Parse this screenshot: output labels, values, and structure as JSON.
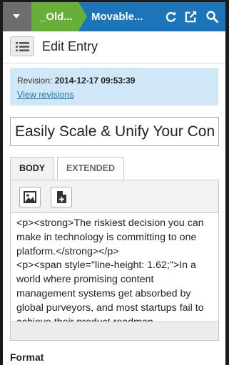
{
  "topbar": {
    "breadcrumb_site": "_Old...",
    "breadcrumb_app": "Movable...",
    "icons": [
      "menu-caret-icon",
      "refresh-icon",
      "external-link-icon",
      "search-icon"
    ],
    "colors": {
      "bar": "#1d75b9",
      "site": "#66b03a",
      "menu": "#6d6d6d"
    }
  },
  "toolbar": {
    "title": "Edit Entry",
    "list_icon": "list-icon"
  },
  "revision": {
    "label": "Revision:",
    "value": "2014-12-17 09:53:39",
    "link": "View revisions"
  },
  "entry": {
    "title_value": "Easily Scale & Unify Your Content"
  },
  "tabs": [
    {
      "label": "BODY",
      "active": true
    },
    {
      "label": "EXTENDED",
      "active": false
    }
  ],
  "editor": {
    "buttons": [
      "insert-image-icon",
      "insert-file-icon"
    ],
    "body_html": "<p><strong>The riskiest decision you can make in technology is committing to one platform.</strong></p>\n<p><span style=\"line-height: 1.62;\">In a world where promising content management systems get absorbed by global purveyors, and most startups fail to achieve their product roadmap,"
  },
  "format": {
    "label": "Format"
  }
}
